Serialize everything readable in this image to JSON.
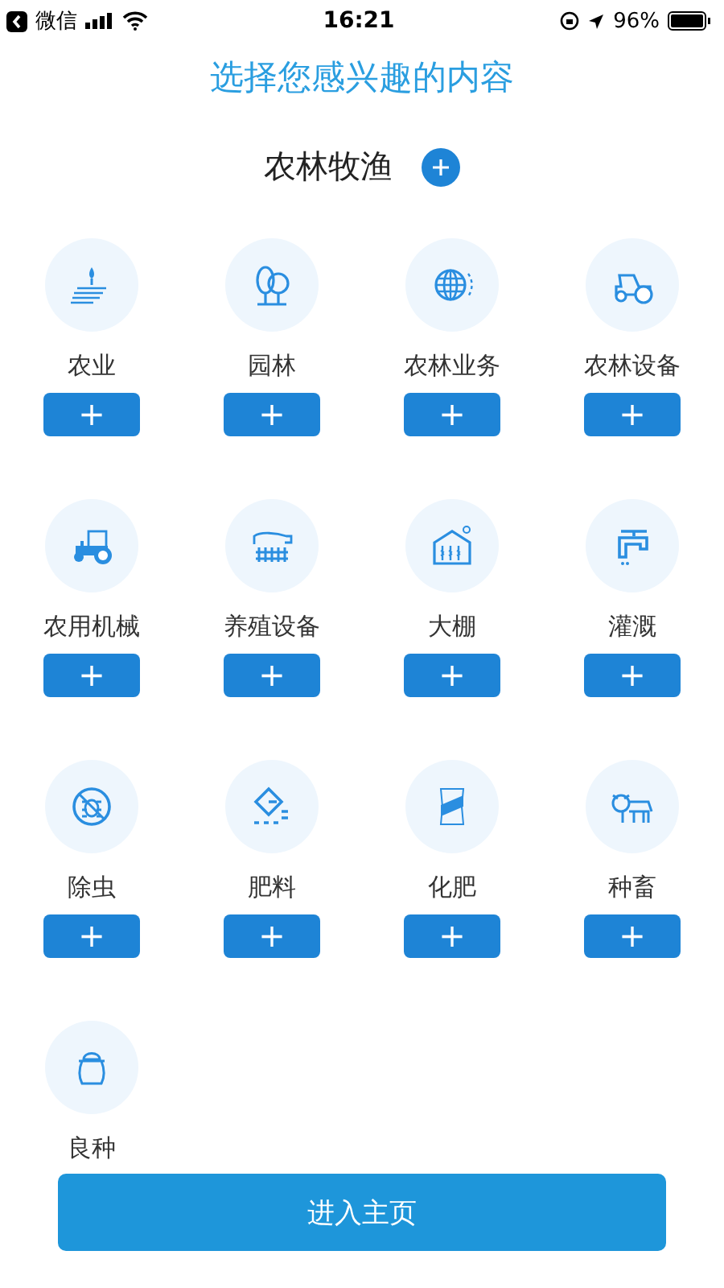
{
  "status_bar": {
    "back_app": "微信",
    "time": "16:21",
    "battery": "96%"
  },
  "title": "选择您感兴趣的内容",
  "section": {
    "name": "农林牧渔"
  },
  "items": [
    {
      "label": "农业",
      "add_button": "+"
    },
    {
      "label": "园林",
      "add_button": "+"
    },
    {
      "label": "农林业务",
      "add_button": "+"
    },
    {
      "label": "农林设备",
      "add_button": "+"
    },
    {
      "label": "农用机械",
      "add_button": "+"
    },
    {
      "label": "养殖设备",
      "add_button": "+"
    },
    {
      "label": "大棚",
      "add_button": "+"
    },
    {
      "label": "灌溉",
      "add_button": "+"
    },
    {
      "label": "除虫",
      "add_button": "+"
    },
    {
      "label": "肥料",
      "add_button": "+"
    },
    {
      "label": "化肥",
      "add_button": "+"
    },
    {
      "label": "种畜",
      "add_button": "+"
    },
    {
      "label": "良种"
    }
  ],
  "enter_button": "进入主页"
}
